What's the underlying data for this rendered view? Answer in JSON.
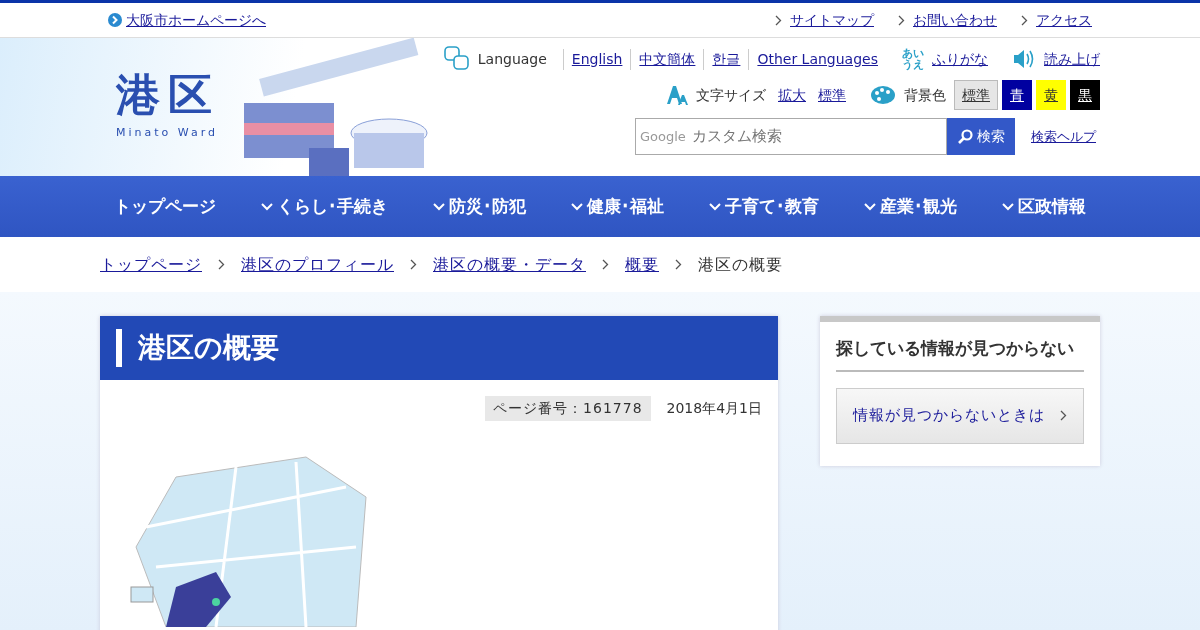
{
  "top_bar": {
    "home_link": "大阪市ホームページへ",
    "links": [
      "サイトマップ",
      "お問い合わせ",
      "アクセス"
    ]
  },
  "logo": {
    "title": "港区",
    "subtitle": "Minato Ward"
  },
  "language": {
    "label": "Language",
    "links": [
      "English",
      "中文簡体",
      "한글",
      "Other Languages"
    ]
  },
  "furigana": {
    "icon_lines": [
      "あい",
      "うえ"
    ],
    "link": "ふりがな"
  },
  "read_aloud": {
    "link": "読み上げ"
  },
  "text_size": {
    "label": "文字サイズ",
    "options": [
      "拡大",
      "標準"
    ]
  },
  "background_color": {
    "label": "背景色",
    "options": [
      {
        "label": "標準",
        "selected": true,
        "color": "#e6e6e6"
      },
      {
        "label": "青",
        "selected": false,
        "color": "#0000a0"
      },
      {
        "label": "黄",
        "selected": false,
        "color": "#ffff00"
      },
      {
        "label": "黒",
        "selected": false,
        "color": "#000000"
      }
    ]
  },
  "search": {
    "brand": "Google",
    "placeholder": "カスタム検索",
    "button": "検索",
    "help": "検索ヘルプ"
  },
  "nav": [
    {
      "label": "トップページ",
      "dropdown": false
    },
    {
      "label": "くらし･手続き",
      "dropdown": true
    },
    {
      "label": "防災･防犯",
      "dropdown": true
    },
    {
      "label": "健康･福祉",
      "dropdown": true
    },
    {
      "label": "子育て･教育",
      "dropdown": true
    },
    {
      "label": "産業･観光",
      "dropdown": true
    },
    {
      "label": "区政情報",
      "dropdown": true
    }
  ],
  "breadcrumb": [
    {
      "label": "トップページ",
      "link": true
    },
    {
      "label": "港区のプロフィール",
      "link": true
    },
    {
      "label": "港区の概要・データ",
      "link": true
    },
    {
      "label": "概要",
      "link": true
    },
    {
      "label": "港区の概要",
      "link": false
    }
  ],
  "page": {
    "title": "港区の概要",
    "page_number": "ページ番号：161778",
    "date": "2018年4月1日"
  },
  "sidebar": {
    "title": "探している情報が見つからない",
    "button": "情報が見つからないときは"
  }
}
